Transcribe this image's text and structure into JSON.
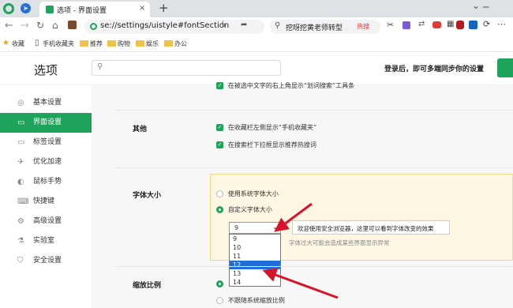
{
  "tab": {
    "title": "选项 - 界面设置"
  },
  "toolbar": {
    "address": "se://settings/uistyle#fontSection",
    "search_text": "挖呀挖黄老师转型",
    "hot_label": "热搜"
  },
  "bookmarks": {
    "items": [
      "收藏",
      "手机收藏夹",
      "推荐",
      "购物",
      "娱乐",
      "办公"
    ]
  },
  "header": {
    "title": "选项",
    "login_text": "登录后，即可多端同步你的设置"
  },
  "sidebar": {
    "items": [
      {
        "label": "基本设置",
        "icon": "settings-circle-icon"
      },
      {
        "label": "界面设置",
        "icon": "window-icon",
        "active": true
      },
      {
        "label": "标签设置",
        "icon": "tab-icon"
      },
      {
        "label": "优化加速",
        "icon": "rocket-icon"
      },
      {
        "label": "鼠标手势",
        "icon": "mouse-icon"
      },
      {
        "label": "快捷键",
        "icon": "keyboard-icon"
      },
      {
        "label": "高级设置",
        "icon": "advanced-icon"
      },
      {
        "label": "实验室",
        "icon": "flask-icon"
      },
      {
        "label": "安全设置",
        "icon": "shield-icon"
      }
    ]
  },
  "content": {
    "top_option": "在被选中文字的右上角显示“划词搜索”工具条",
    "other_label": "其他",
    "other_options": [
      "在收藏栏左侧显示“手机收藏夹”",
      "在搜索栏下拉框显示推荐热搜词"
    ],
    "font_size_label": "字体大小",
    "font_radio_system": "使用系统字体大小",
    "font_radio_custom": "自定义字体大小",
    "font_selected": "9",
    "font_options": [
      "9",
      "10",
      "11",
      "12",
      "13",
      "14"
    ],
    "font_highlighted": "12",
    "preview_text": "欢迎使用安全浏览器，这里可以看到字体改变的效果",
    "warning_text": "字体过大可能会造成某些界面显示异常",
    "zoom_label": "缩放比例",
    "zoom_option": "不跟随系统缩放比例"
  },
  "colors": {
    "accent": "#1ea35a",
    "highlight_bg": "#fdf6e3",
    "arrow": "#d9142a",
    "select_blue": "#1e6fd9"
  }
}
